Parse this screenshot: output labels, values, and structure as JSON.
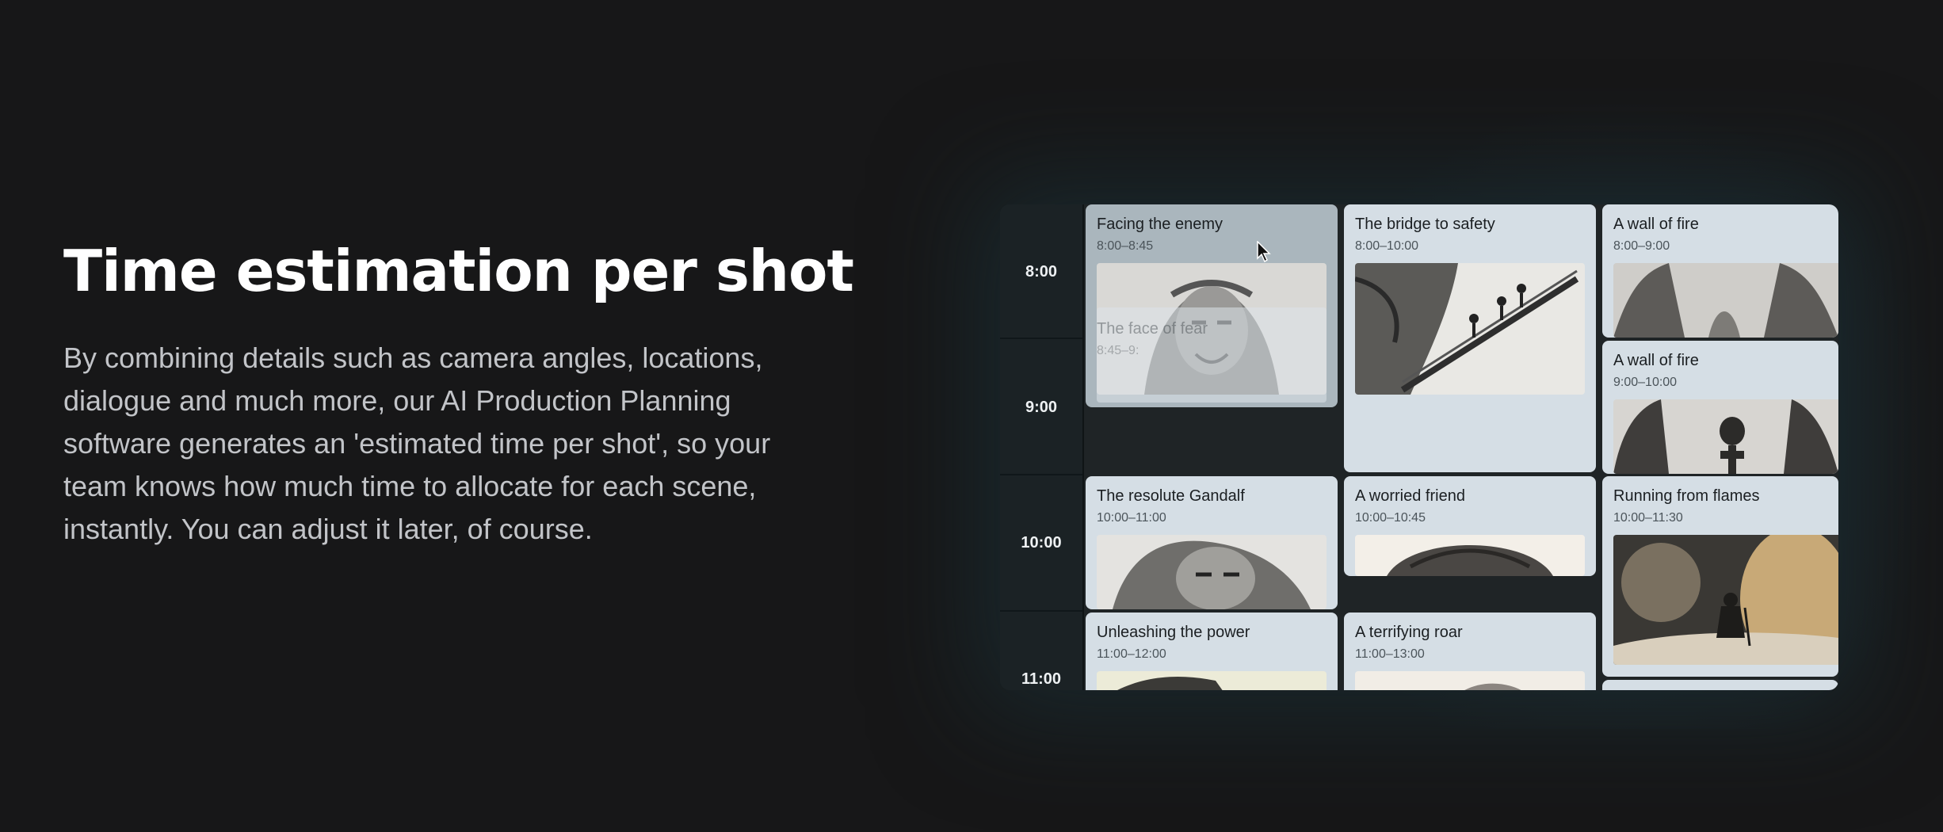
{
  "hero": {
    "title": "Time estimation per shot",
    "description": "By combining details such as camera angles, locations, dialogue and much more, our AI Production Planning software generates an 'estimated time per shot', so your team knows how much time to allocate for each scene, instantly. You can adjust it later, of course."
  },
  "schedule": {
    "time_labels": [
      "8:00",
      "9:00",
      "10:00",
      "11:00"
    ],
    "cards": [
      {
        "title": "Facing the enemy",
        "time": "8:00–8:45"
      },
      {
        "title": "The bridge to safety",
        "time": "8:00–10:00"
      },
      {
        "title": "A wall of fire",
        "time": "8:00–9:00"
      },
      {
        "title": "A wall of fire",
        "time": "9:00–10:00"
      },
      {
        "title": "The resolute Gandalf",
        "time": "10:00–11:00"
      },
      {
        "title": "A worried friend",
        "time": "10:00–10:45"
      },
      {
        "title": "Running from flames",
        "time": "10:00–11:30"
      },
      {
        "title": "Unleashing the power",
        "time": "11:00–12:00"
      },
      {
        "title": "A terrifying roar",
        "time": "11:00–13:00"
      }
    ],
    "drag_ghost": {
      "title": "The face of fear",
      "time": "8:45–9:"
    }
  },
  "colors": {
    "background": "#171718",
    "card": "#d5dee5",
    "card_dragging": "#aab6bd",
    "time_column": "#1b2225"
  },
  "icons": [
    "mouse-pointer-icon"
  ]
}
